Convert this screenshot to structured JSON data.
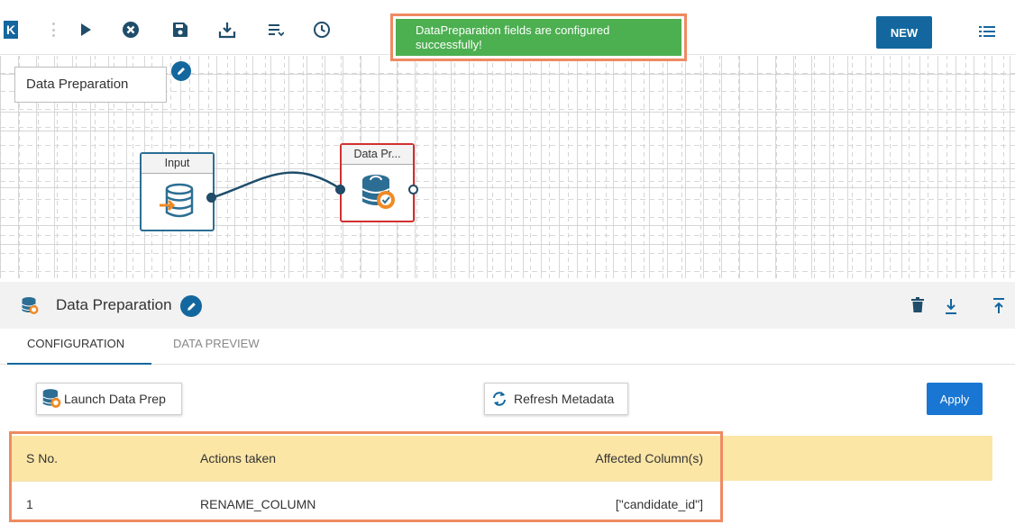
{
  "toolbar": {
    "collapse_label": "K",
    "new_label": "NEW"
  },
  "toast": {
    "message": "DataPreparation fields are configured successfully!"
  },
  "canvas": {
    "pipeline_name": "Data Preparation",
    "nodes": [
      {
        "title": "Input"
      },
      {
        "title": "Data Pr..."
      }
    ]
  },
  "panel": {
    "title": "Data Preparation",
    "tabs": [
      {
        "label": "CONFIGURATION",
        "active": true
      },
      {
        "label": "DATA PREVIEW",
        "active": false
      }
    ],
    "launch_label": "Launch Data Prep",
    "refresh_label": "Refresh Metadata",
    "apply_label": "Apply"
  },
  "table": {
    "headers": [
      "S No.",
      "Actions taken",
      "Affected Column(s)"
    ],
    "rows": [
      [
        "1",
        "RENAME_COLUMN",
        "[\"candidate_id\"]"
      ]
    ]
  },
  "colors": {
    "primary": "#13679e",
    "toast_bg": "#4caf50",
    "highlight_border": "#ef8a62",
    "table_header_bg": "#fbe6a6",
    "node_selected_border": "#d32f2f",
    "apply_bg": "#1976d2"
  }
}
